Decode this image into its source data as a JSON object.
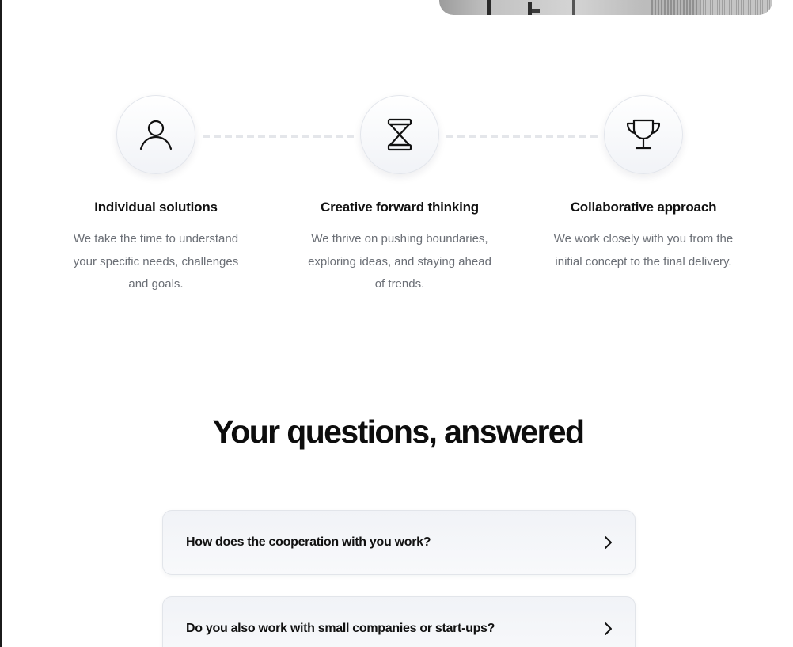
{
  "features": [
    {
      "title": "Individual solutions",
      "description": "We take the time to understand your specific needs, challenges and goals.",
      "icon": "user-icon"
    },
    {
      "title": "Creative forward thinking",
      "description": "We thrive on pushing boundaries, exploring ideas, and staying ahead of trends.",
      "icon": "hourglass-icon"
    },
    {
      "title": "Collaborative approach",
      "description": "We work closely with you from the initial concept to the final delivery.",
      "icon": "trophy-icon"
    }
  ],
  "faq": {
    "title": "Your questions, answered",
    "items": [
      {
        "question": "How does the cooperation with you work?",
        "icon": "chevron-right-icon"
      },
      {
        "question": "Do you also work with small companies or start-ups?",
        "icon": "chevron-right-icon"
      }
    ]
  },
  "colors": {
    "text": "#111111",
    "muted_text": "#6b6f76",
    "card_background": "#f1f3f7",
    "border": "#e2e5ea"
  }
}
